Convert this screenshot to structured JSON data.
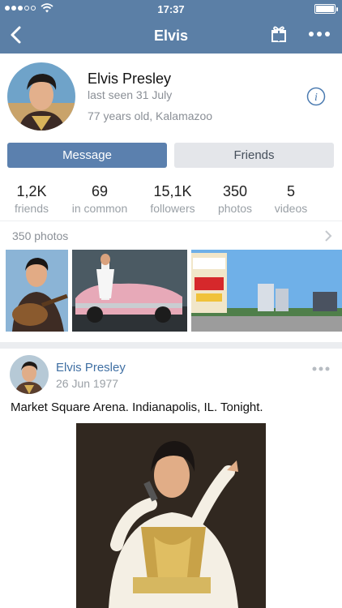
{
  "status_bar": {
    "time": "17:37"
  },
  "nav": {
    "title": "Elvis",
    "back_icon": "back-chevron-icon",
    "gift_icon": "gift-icon",
    "more_icon": "more-dots-icon"
  },
  "profile": {
    "name": "Elvis Presley",
    "last_seen": "last seen 31 July",
    "info": "77 years old, Kalamazoo",
    "info_icon": "info-icon"
  },
  "actions": {
    "message": "Message",
    "friends": "Friends"
  },
  "counters": [
    {
      "value": "1,2K",
      "label": "friends"
    },
    {
      "value": "69",
      "label": "in common"
    },
    {
      "value": "15,1K",
      "label": "followers"
    },
    {
      "value": "350",
      "label": "photos"
    },
    {
      "value": "5",
      "label": "videos"
    }
  ],
  "photos": {
    "label": "350 photos"
  },
  "post": {
    "author": "Elvis Presley",
    "date": "26 Jun 1977",
    "text": "Market Square Arena. Indianapolis, IL. Tonight."
  },
  "colors": {
    "brand": "#5b7fa6",
    "button": "#5b80ae",
    "link": "#3f6fa3"
  }
}
